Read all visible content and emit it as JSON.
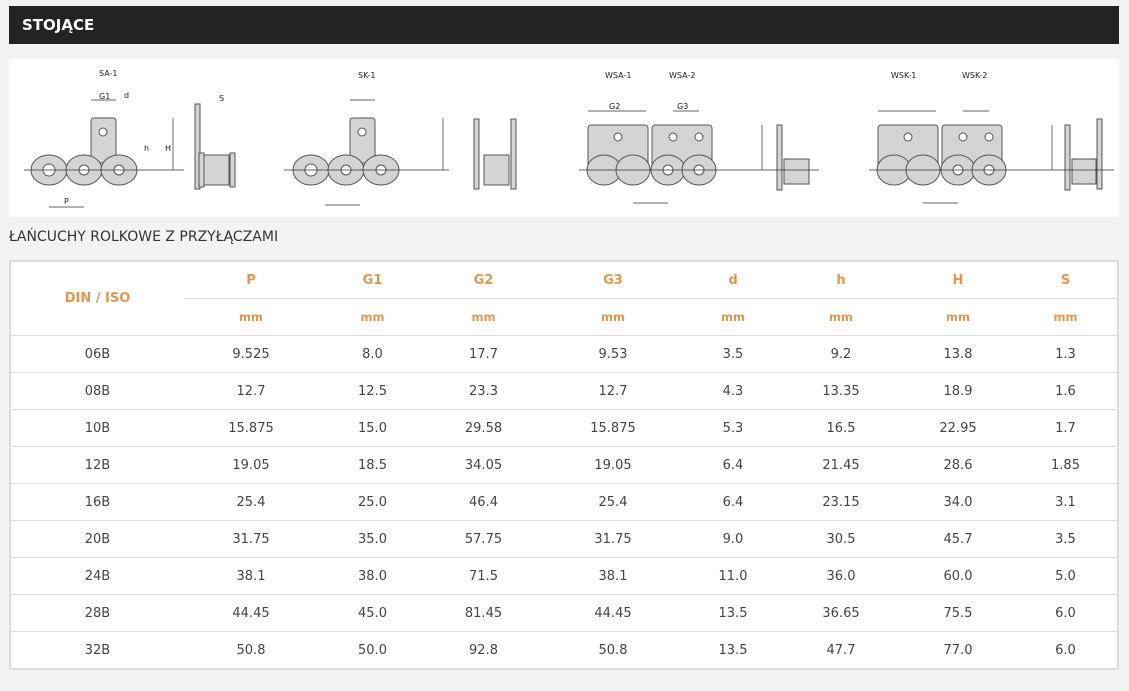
{
  "header": {
    "title": "STOJĄCE"
  },
  "diagrams": {
    "labels": [
      "SA-1",
      "SK-1",
      "WSA-1",
      "WSA-2",
      "WSK-1",
      "WSK-2"
    ],
    "dims": {
      "G1": "G1",
      "G2": "G2",
      "G3": "G3",
      "d": "d",
      "h": "h",
      "H": "H",
      "S": "S",
      "P": "P"
    }
  },
  "section_title": "ŁAŃCUCHY ROLKOWE Z PRZYŁĄCZAMI",
  "table": {
    "first_header": "DIN / ISO",
    "columns": [
      "P",
      "G1",
      "G2",
      "G3",
      "d",
      "h",
      "H",
      "S"
    ],
    "units": [
      "mm",
      "mm",
      "mm",
      "mm",
      "mm",
      "mm",
      "mm",
      "mm"
    ],
    "rows": [
      [
        "06B",
        "9.525",
        "8.0",
        "17.7",
        "9.53",
        "3.5",
        "9.2",
        "13.8",
        "1.3"
      ],
      [
        "08B",
        "12.7",
        "12.5",
        "23.3",
        "12.7",
        "4.3",
        "13.35",
        "18.9",
        "1.6"
      ],
      [
        "10B",
        "15.875",
        "15.0",
        "29.58",
        "15.875",
        "5.3",
        "16.5",
        "22.95",
        "1.7"
      ],
      [
        "12B",
        "19.05",
        "18.5",
        "34.05",
        "19.05",
        "6.4",
        "21.45",
        "28.6",
        "1.85"
      ],
      [
        "16B",
        "25.4",
        "25.0",
        "46.4",
        "25.4",
        "6.4",
        "23.15",
        "34.0",
        "3.1"
      ],
      [
        "20B",
        "31.75",
        "35.0",
        "57.75",
        "31.75",
        "9.0",
        "30.5",
        "45.7",
        "3.5"
      ],
      [
        "24B",
        "38.1",
        "38.0",
        "71.5",
        "38.1",
        "11.0",
        "36.0",
        "60.0",
        "5.0"
      ],
      [
        "28B",
        "44.45",
        "45.0",
        "81.45",
        "44.45",
        "13.5",
        "36.65",
        "75.5",
        "6.0"
      ],
      [
        "32B",
        "50.8",
        "50.0",
        "92.8",
        "50.8",
        "13.5",
        "47.7",
        "77.0",
        "6.0"
      ]
    ]
  }
}
